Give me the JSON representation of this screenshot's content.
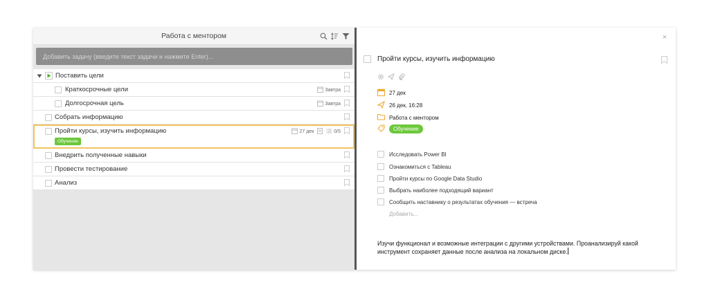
{
  "left": {
    "title": "Работа с ментором",
    "add_placeholder": "Добавить задачу (введите текст задачи и нажмите Enter)..."
  },
  "tasks": {
    "goal": {
      "label": "Поставить цели"
    },
    "short": {
      "label": "Краткосрочные цели",
      "date": "Завтра"
    },
    "long": {
      "label": "Долгосрочная цель",
      "date": "Завтра"
    },
    "collect": {
      "label": "Собрать информацию"
    },
    "courses": {
      "label": "Пройти курсы, изучить информацию",
      "date": "27 дек",
      "subtasks": "0/5",
      "tag": "Обучение"
    },
    "apply": {
      "label": "Внедрить полученные навыки"
    },
    "test": {
      "label": "Провести тестирование"
    },
    "analysis": {
      "label": "Анализ"
    }
  },
  "detail": {
    "close": "×",
    "title": "Пройти курсы, изучить информацию",
    "due_date": "27 дек",
    "reminder": "26 дек, 16:28",
    "project": "Работа с ментором",
    "tag": "Обучение",
    "subtasks": [
      "Исследовать Power BI",
      "Ознакомиться с Tableau",
      "Пройти курсы по Google Data Studio",
      "Выбрать наиболее подходящий вариант",
      "Сообщить наставнику о результатах обучения — встреча"
    ],
    "add_subtask": "Добавить...",
    "note": "Изучи функционал и возможные интеграции с другими устройствами. Проанализируй какой инструмент сохраняет данные после анализа на локальном диске."
  },
  "colors": {
    "accent_green": "#6cc83b",
    "selection_border": "#f2c35f",
    "calendar_orange": "#f0a830"
  }
}
